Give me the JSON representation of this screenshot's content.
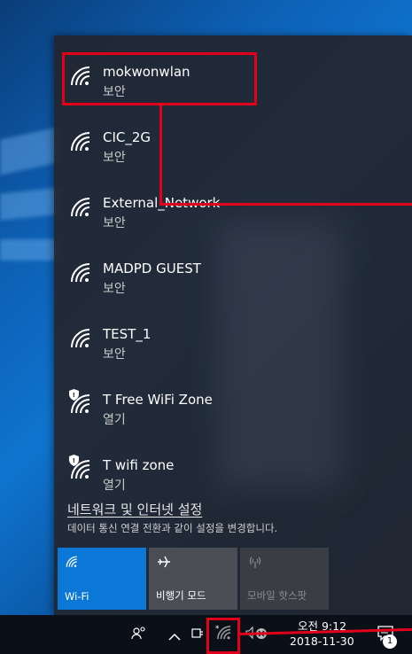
{
  "networks": [
    {
      "name": "mokwonwlan",
      "status": "보안",
      "open": false
    },
    {
      "name": "CIC_2G",
      "status": "보안",
      "open": false
    },
    {
      "name": "External_Network",
      "status": "보안",
      "open": false
    },
    {
      "name": "MADPD GUEST",
      "status": "보안",
      "open": false
    },
    {
      "name": "TEST_1",
      "status": "보안",
      "open": false
    },
    {
      "name": "T Free WiFi Zone",
      "status": "열기",
      "open": true
    },
    {
      "name": "T wifi zone",
      "status": "열기",
      "open": true
    }
  ],
  "settings": {
    "link": "네트워크 및 인터넷 설정",
    "description": "데이터 통신 연결 전환과 같이 설정을 변경합니다."
  },
  "quick_actions": [
    {
      "label": "Wi-Fi",
      "icon": "wifi-icon",
      "active": true
    },
    {
      "label": "비행기 모드",
      "icon": "airplane-icon",
      "active": false
    },
    {
      "label": "모바일 핫스팟",
      "icon": "hotspot-icon",
      "active": false
    }
  ],
  "taskbar": {
    "time": "오전 9:12",
    "date": "2018-11-30",
    "notification_count": "1"
  },
  "colors": {
    "accent": "#0b78d7",
    "annotation": "#e3001b"
  }
}
